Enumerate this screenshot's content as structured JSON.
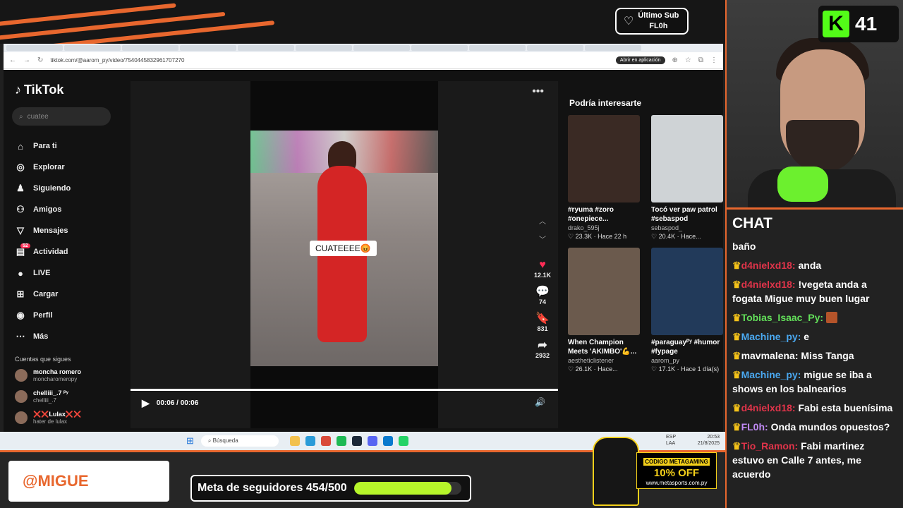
{
  "overlay": {
    "sub_label": "Último Sub",
    "sub_name": "FL0h",
    "kick_count": "41",
    "kick_logo": "K",
    "brand": "@MIGUE",
    "goal_label": "Meta de seguidores 454/500",
    "goal_fraction": 0.908,
    "promo": {
      "code": "CODIGO METAGAMING",
      "discount": "10% OFF",
      "site": "www.metasports.com.py"
    }
  },
  "browser": {
    "url": "tiktok.com/@aarom_py/video/7540445832961707270",
    "open_app": "Abrir en aplicación"
  },
  "tiktok": {
    "logo": "TikTok",
    "search_value": "cuatee",
    "menu": [
      {
        "label": "Para ti",
        "icon": "home-icon"
      },
      {
        "label": "Explorar",
        "icon": "compass-icon"
      },
      {
        "label": "Siguiendo",
        "icon": "following-icon"
      },
      {
        "label": "Amigos",
        "icon": "friends-icon"
      },
      {
        "label": "Mensajes",
        "icon": "messages-icon"
      },
      {
        "label": "Actividad",
        "icon": "activity-icon",
        "badge": "52"
      },
      {
        "label": "LIVE",
        "icon": "live-icon"
      },
      {
        "label": "Cargar",
        "icon": "upload-icon"
      },
      {
        "label": "Perfil",
        "icon": "profile-icon"
      },
      {
        "label": "Más",
        "icon": "more-icon"
      }
    ],
    "following_title": "Cuentas que sigues",
    "following": [
      {
        "name": "moncha romero",
        "handle": "moncharomeropy"
      },
      {
        "name": "chelliii_.7 ᴾʸ",
        "handle": "chelliii_.7"
      },
      {
        "name": "❌❌Lulax❌❌",
        "handle": "hater de lulax"
      }
    ],
    "video": {
      "caption": "CUATEEEE😡",
      "likes": "12.1K",
      "comments": "74",
      "saves": "831",
      "shares": "2932",
      "time": "00:06 / 00:06",
      "author_partial": "aarom_py"
    },
    "recs_title": "Podría interesarte",
    "recs": [
      {
        "caption": "#ryuma  #zoro #onepiece...",
        "author": "drako_595j",
        "meta": "♡ 23.3K · Hace 22 h"
      },
      {
        "caption": "Tocó ver paw patrol #sebaspod",
        "author": "sebaspod_",
        "meta": "♡ 20.4K · Hace..."
      },
      {
        "caption": "When Champion Meets 'AKIMBO'💪...",
        "author": "aestheticlistener",
        "meta": "♡ 26.1K · Hace..."
      },
      {
        "caption": "#paraguayᴾʸ #humor #fypage",
        "author": "aarom_py",
        "meta": "♡ 17.1K · Hace 1 día(s)"
      }
    ]
  },
  "taskbar": {
    "search": "Búsqueda",
    "lang": "ESP\nLAA",
    "clock_time": "20:53",
    "clock_date": "21/8/2025"
  },
  "chat": {
    "title": "CHAT",
    "messages": [
      {
        "user": "",
        "text": "baño",
        "color": "#ffffff"
      },
      {
        "user": "d4nielxd18:",
        "text": "anda",
        "color": "#e0344a"
      },
      {
        "user": "d4nielxd18:",
        "text": "!vegeta anda a fogata Migue muy buen lugar",
        "color": "#e0344a"
      },
      {
        "user": "Tobias_Isaac_Py:",
        "text": "",
        "color": "#63e05a"
      },
      {
        "user": "Machine_py:",
        "text": "e",
        "color": "#4aa8f0"
      },
      {
        "user": "mavmalena:",
        "text": "Miss Tanga",
        "color": "#ffffff"
      },
      {
        "user": "Machine_py:",
        "text": "migue se iba a shows en los balnearios",
        "color": "#4aa8f0"
      },
      {
        "user": "d4nielxd18:",
        "text": "Fabi esta buenísima",
        "color": "#e0344a"
      },
      {
        "user": "FL0h:",
        "text": "Onda mundos opuestos?",
        "color": "#c08af5"
      },
      {
        "user": "Tio_Ramon:",
        "text": "Fabi martinez estuvo en Calle 7 antes, me acuerdo",
        "color": "#e0344a"
      }
    ]
  }
}
